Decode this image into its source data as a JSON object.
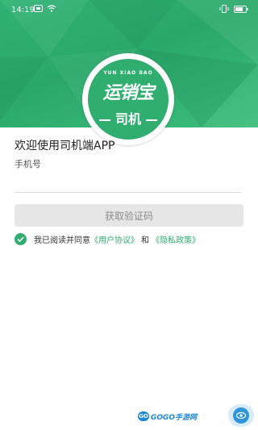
{
  "status_bar": {
    "time": "14:19",
    "left_icons": [
      "app-notification-icon",
      "wifi-icon"
    ],
    "right_icons": [
      "vibrate-icon",
      "battery-icon"
    ]
  },
  "logo": {
    "arc_text": "YUN XIAO BAO",
    "brand": "运销宝",
    "role": "司机"
  },
  "welcome": "欢迎使用司机端APP",
  "phone": {
    "label": "手机号",
    "value": "",
    "placeholder": ""
  },
  "get_code_button": "获取验证码",
  "agreement": {
    "prefix": "我已阅读并同意",
    "user_agreement": "《用户协议》",
    "and": "和",
    "privacy_policy": "《隐私政策》",
    "checked": true
  },
  "watermark": {
    "icon_text": "GO",
    "text": "GOGO手游网"
  },
  "colors": {
    "brand_green": "#2fae6f",
    "button_disabled": "#e6e6e6",
    "fab_blue": "#2f95d8"
  }
}
